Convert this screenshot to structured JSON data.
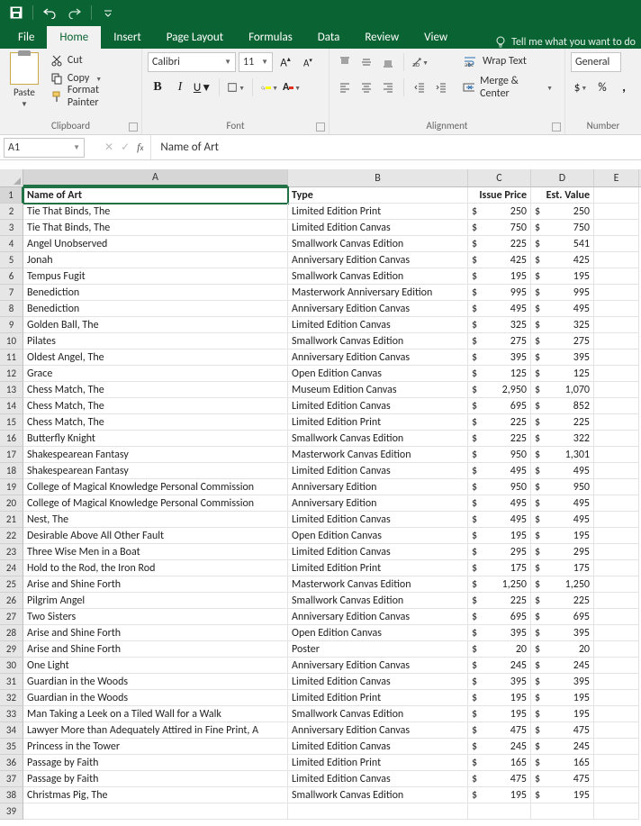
{
  "titlebar": {
    "save": "save-icon",
    "undo": "undo-icon",
    "redo": "redo-icon"
  },
  "tabs": {
    "file": "File",
    "home": "Home",
    "insert": "Insert",
    "pagelayout": "Page Layout",
    "formulas": "Formulas",
    "data": "Data",
    "review": "Review",
    "view": "View",
    "tell": "Tell me what you want to do"
  },
  "ribbon": {
    "clipboard": {
      "paste": "Paste",
      "cut": "Cut",
      "copy": "Copy",
      "formatpainter": "Format Painter",
      "label": "Clipboard"
    },
    "font": {
      "name": "Calibri",
      "size": "11",
      "label": "Font"
    },
    "alignment": {
      "wrap": "Wrap Text",
      "merge": "Merge & Center",
      "label": "Alignment"
    },
    "number": {
      "format": "General",
      "label": "Number"
    }
  },
  "namebox": "A1",
  "formula_value": "Name of Art",
  "columns": [
    "A",
    "B",
    "C",
    "D",
    "E"
  ],
  "headers": {
    "A": "Name of Art",
    "B": "Type",
    "C": "Issue Price",
    "D": "Est. Value"
  },
  "rows": [
    {
      "a": "Tie That Binds, The",
      "b": "Limited Edition Print",
      "c": "250",
      "d": "250"
    },
    {
      "a": "Tie That Binds, The",
      "b": "Limited Edition Canvas",
      "c": "750",
      "d": "750"
    },
    {
      "a": "Angel Unobserved",
      "b": "Smallwork Canvas Edition",
      "c": "225",
      "d": "541"
    },
    {
      "a": "Jonah",
      "b": "Anniversary Edition Canvas",
      "c": "425",
      "d": "425"
    },
    {
      "a": "Tempus Fugit",
      "b": "Smallwork Canvas Edition",
      "c": "195",
      "d": "195"
    },
    {
      "a": "Benediction",
      "b": "Masterwork Anniversary Edition",
      "c": "995",
      "d": "995"
    },
    {
      "a": "Benediction",
      "b": "Anniversary Edition Canvas",
      "c": "495",
      "d": "495"
    },
    {
      "a": "Golden Ball, The",
      "b": "Limited Edition Canvas",
      "c": "325",
      "d": "325"
    },
    {
      "a": "Pilates",
      "b": "Smallwork Canvas Edition",
      "c": "275",
      "d": "275"
    },
    {
      "a": "Oldest Angel, The",
      "b": "Anniversary Edition Canvas",
      "c": "395",
      "d": "395"
    },
    {
      "a": "Grace",
      "b": "Open Edition Canvas",
      "c": "125",
      "d": "125"
    },
    {
      "a": "Chess Match, The",
      "b": "Museum Edition Canvas",
      "c": "2,950",
      "d": "1,070"
    },
    {
      "a": "Chess Match, The",
      "b": "Limited Edition Canvas",
      "c": "695",
      "d": "852"
    },
    {
      "a": "Chess Match, The",
      "b": "Limited Edition Print",
      "c": "225",
      "d": "225"
    },
    {
      "a": "Butterfly Knight",
      "b": "Smallwork Canvas Edition",
      "c": "225",
      "d": "322"
    },
    {
      "a": "Shakespearean Fantasy",
      "b": "Masterwork Canvas Edition",
      "c": "950",
      "d": "1,301"
    },
    {
      "a": "Shakespearean Fantasy",
      "b": "Limited Edition Canvas",
      "c": "495",
      "d": "495"
    },
    {
      "a": "College of Magical Knowledge Personal Commission",
      "b": "Anniversary Edition",
      "c": "950",
      "d": "950"
    },
    {
      "a": "College of Magical Knowledge Personal Commission",
      "b": "Anniversary Edition",
      "c": "495",
      "d": "495"
    },
    {
      "a": "Nest, The",
      "b": "Limited Edition Canvas",
      "c": "495",
      "d": "495"
    },
    {
      "a": "Desirable Above All Other Fault",
      "b": "Open Edition Canvas",
      "c": "195",
      "d": "195"
    },
    {
      "a": "Three Wise Men in a Boat",
      "b": "Limited Edition Canvas",
      "c": "295",
      "d": "295"
    },
    {
      "a": "Hold to the Rod, the Iron Rod",
      "b": "Limited Edition Print",
      "c": "175",
      "d": "175"
    },
    {
      "a": "Arise and Shine Forth",
      "b": "Masterwork Canvas Edition",
      "c": "1,250",
      "d": "1,250"
    },
    {
      "a": "Pilgrim Angel",
      "b": "Smallwork Canvas Edition",
      "c": "225",
      "d": "225"
    },
    {
      "a": "Two Sisters",
      "b": "Anniversary Edition Canvas",
      "c": "695",
      "d": "695"
    },
    {
      "a": "Arise and Shine Forth",
      "b": "Open Edition Canvas",
      "c": "395",
      "d": "395"
    },
    {
      "a": "Arise and Shine Forth",
      "b": "Poster",
      "c": "20",
      "d": "20"
    },
    {
      "a": "One Light",
      "b": "Anniversary Edition Canvas",
      "c": "245",
      "d": "245"
    },
    {
      "a": "Guardian in the Woods",
      "b": "Limited Edition Canvas",
      "c": "395",
      "d": "395"
    },
    {
      "a": "Guardian in the Woods",
      "b": "Limited Edition Print",
      "c": "195",
      "d": "195"
    },
    {
      "a": "Man Taking a Leek on a Tiled Wall for a Walk",
      "b": "Smallwork Canvas Edition",
      "c": "195",
      "d": "195"
    },
    {
      "a": "Lawyer More than Adequately Attired in Fine Print, A",
      "b": "Anniversary Edition Canvas",
      "c": "475",
      "d": "475"
    },
    {
      "a": "Princess in the Tower",
      "b": "Limited Edition Canvas",
      "c": "245",
      "d": "245"
    },
    {
      "a": "Passage by Faith",
      "b": "Limited Edition Print",
      "c": "165",
      "d": "165"
    },
    {
      "a": "Passage by Faith",
      "b": "Limited Edition Canvas",
      "c": "475",
      "d": "475"
    },
    {
      "a": "Christmas Pig, The",
      "b": "Smallwork Canvas Edition",
      "c": "195",
      "d": "195"
    }
  ],
  "currency_symbol": "$"
}
